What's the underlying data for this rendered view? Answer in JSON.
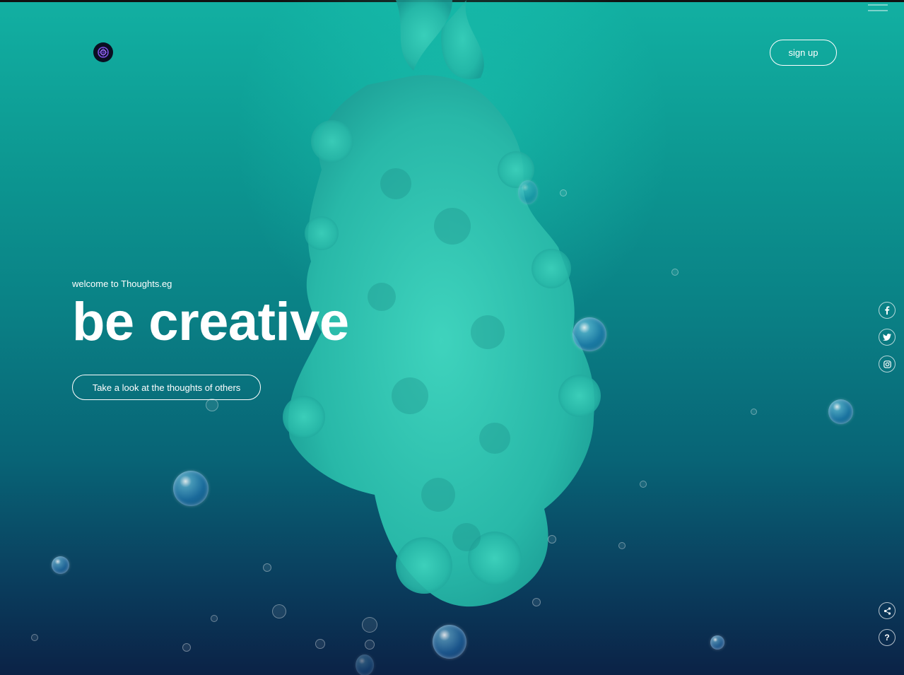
{
  "brand": {
    "logo_icon": "spiral-logo-icon"
  },
  "header": {
    "menu_icon": "hamburger-menu-icon",
    "signup_label": "sign up"
  },
  "hero": {
    "welcome": "welcome to Thoughts.eg",
    "headline": "be creative",
    "cta_label": "Take a look at the thoughts of others"
  },
  "social": [
    {
      "name": "facebook-icon",
      "glyph": "f"
    },
    {
      "name": "twitter-icon",
      "glyph": "t"
    },
    {
      "name": "instagram-icon",
      "glyph": "ig"
    }
  ],
  "utility": [
    {
      "name": "share-icon",
      "glyph": "share"
    },
    {
      "name": "help-icon",
      "glyph": "?"
    }
  ],
  "colors": {
    "background_top": "#12b0a2",
    "background_bottom": "#0b2246",
    "ink": "#2ec8b4",
    "text": "#ffffff"
  }
}
